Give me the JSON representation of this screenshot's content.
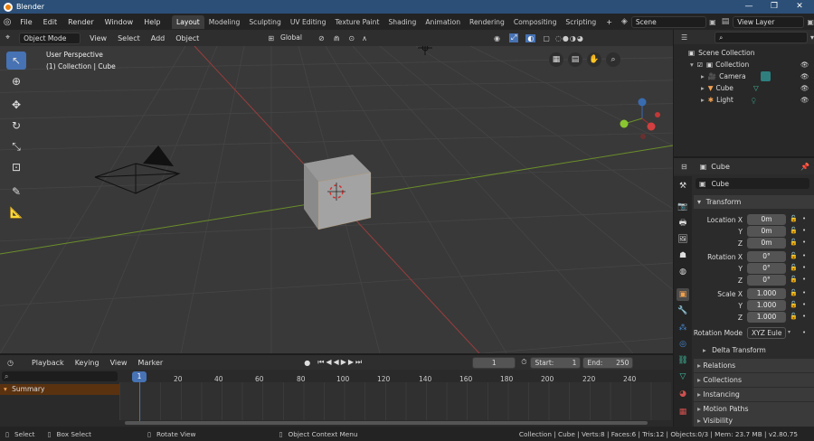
{
  "app": {
    "title": "Blender",
    "win_min": "—",
    "win_max": "❐",
    "win_close": "✕"
  },
  "menu": {
    "items": [
      "File",
      "Edit",
      "Render",
      "Window",
      "Help"
    ]
  },
  "workspaces": [
    "Layout",
    "Modeling",
    "Sculpting",
    "UV Editing",
    "Texture Paint",
    "Shading",
    "Animation",
    "Rendering",
    "Compositing",
    "Scripting"
  ],
  "workspace_add": "+",
  "scene": "Scene",
  "view_layer": "View Layer",
  "viewport": {
    "mode": "Object Mode",
    "menus": [
      "View",
      "Select",
      "Add",
      "Object"
    ],
    "orientation": "Global",
    "overlay_line1": "User Perspective",
    "overlay_line2": "(1) Collection | Cube"
  },
  "outliner": {
    "search_placeholder": "",
    "rows": [
      {
        "label": "Scene Collection"
      },
      {
        "label": "Collection"
      },
      {
        "label": "Camera"
      },
      {
        "label": "Cube"
      },
      {
        "label": "Light"
      }
    ]
  },
  "properties": {
    "object_name": "Cube",
    "data_name": "Cube",
    "transform_title": "Transform",
    "location_label": "Location X",
    "rotation_label": "Rotation X",
    "scale_label": "Scale X",
    "axis_y": "Y",
    "axis_z": "Z",
    "location": [
      "0m",
      "0m",
      "0m"
    ],
    "rotation": [
      "0°",
      "0°",
      "0°"
    ],
    "scale": [
      "1.000",
      "1.000",
      "1.000"
    ],
    "rotation_mode_label": "Rotation Mode",
    "rotation_mode": "XYZ Eule",
    "delta": "Delta Transform",
    "sections": [
      "Relations",
      "Collections",
      "Instancing",
      "Motion Paths",
      "Visibility"
    ]
  },
  "timeline": {
    "menus": [
      "Playback",
      "Keying",
      "View",
      "Marker"
    ],
    "current_frame": "1",
    "start_label": "Start:",
    "start": "1",
    "end_label": "End:",
    "end": "250",
    "summary": "Summary",
    "ticks": [
      "1",
      "20",
      "40",
      "60",
      "80",
      "100",
      "120",
      "140",
      "160",
      "180",
      "200",
      "220",
      "240"
    ]
  },
  "status": {
    "select": "Select",
    "box_select": "Box Select",
    "rotate_view": "Rotate View",
    "context_menu": "Object Context Menu",
    "info": "Collection | Cube | Verts:8 | Faces:6 | Tris:12 | Objects:0/3 | Mem: 23.7 MB | v2.80.75"
  },
  "colors": {
    "accent": "#4772b3",
    "title_bar": "#2b4f77",
    "x_axis": "#9a3d3d",
    "y_axis": "#6b8e2a"
  }
}
